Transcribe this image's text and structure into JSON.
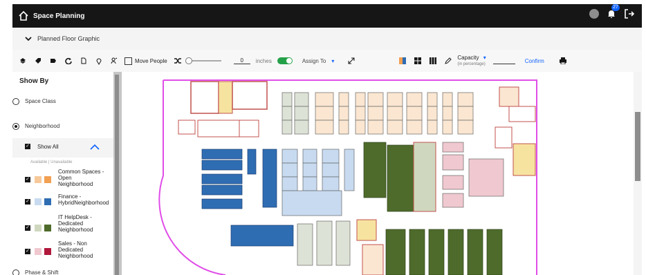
{
  "app": {
    "title": "Space Planning",
    "notifications": "27"
  },
  "section": {
    "title": "Planned Floor Graphic"
  },
  "toolbar": {
    "move_people": "Move People",
    "offset_value": "0",
    "unit": "inches",
    "assign_to": "Assign To",
    "capacity_label": "Capacity",
    "capacity_sub": "(in percentage)",
    "confirm": "Confirm"
  },
  "sidebar": {
    "title": "Show By",
    "options": [
      "Space Class",
      "Neighborhood"
    ],
    "show_all": "Show All",
    "legend_header": "Available | Unavailable",
    "legend": [
      {
        "label": "Common Spaces - Open Neighborhood",
        "available": "#f7c99a",
        "unavailable": "#f2a052"
      },
      {
        "label": "Finance - HybridNeighborhood",
        "available": "#c7daf0",
        "unavailable": "#2f6db3"
      },
      {
        "label": "IT HelpDesk - Dedicated Neighborhood",
        "available": "#cfd8bf",
        "unavailable": "#4e6b2b"
      },
      {
        "label": "Sales - Non Dedicated Neighborhood",
        "available": "#f0c8cf",
        "unavailable": "#b0183c"
      }
    ],
    "last_option": "Phase & Shift"
  },
  "colors": {
    "header_bg": "#161616",
    "accent": "#0f62fe",
    "toggle_on": "#24a148",
    "wall_outline": "#e04de8",
    "room_border": "#c0504d"
  }
}
